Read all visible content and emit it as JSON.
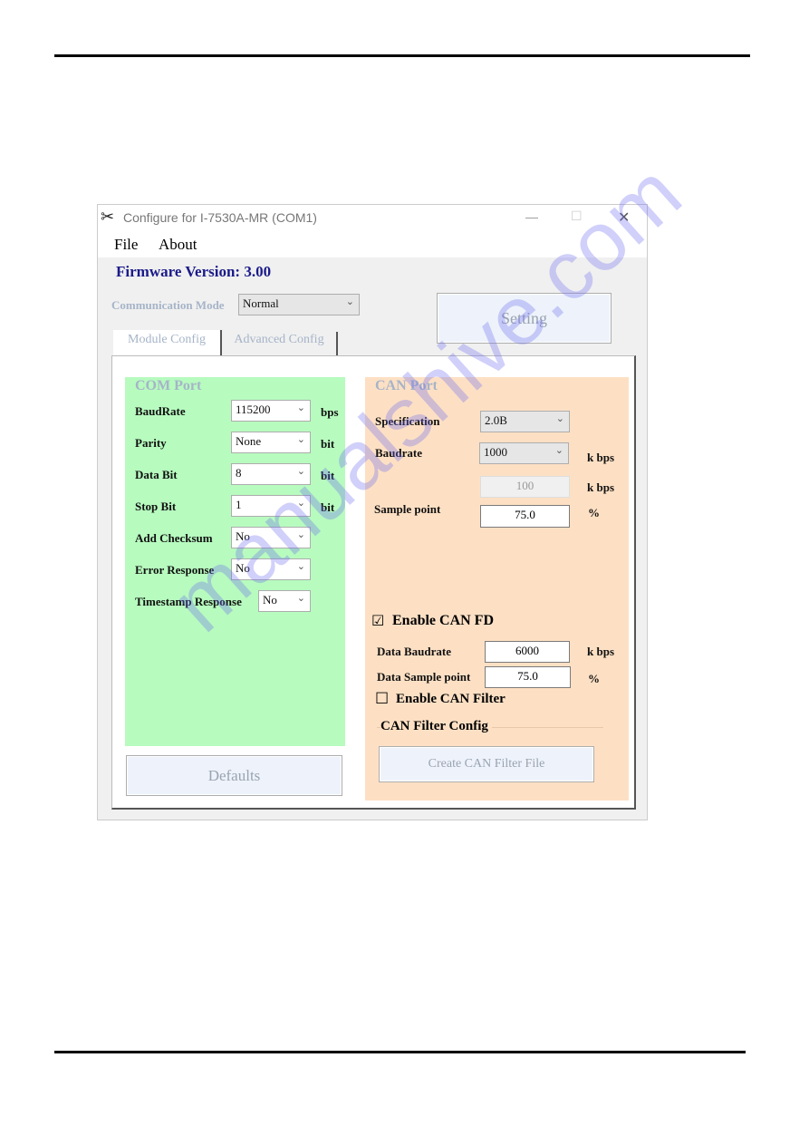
{
  "window": {
    "title": "Configure for I-7530A-MR (COM1)",
    "minimize": "—",
    "maximize": "☐",
    "close": "✕"
  },
  "menu": {
    "file": "File",
    "about": "About"
  },
  "firmware": "Firmware Version: 3.00",
  "comm_mode": {
    "label": "Communication Mode",
    "value": "Normal"
  },
  "setting_button": "Setting",
  "tabs": [
    {
      "label": "Module Config"
    },
    {
      "label": "Advanced Config"
    }
  ],
  "com_port": {
    "title": "COM Port",
    "rows": [
      {
        "label": "BaudRate",
        "value": "115200",
        "unit": "bps"
      },
      {
        "label": "Parity",
        "value": "None",
        "unit": "bit"
      },
      {
        "label": "Data Bit",
        "value": "8",
        "unit": "bit"
      },
      {
        "label": "Stop Bit",
        "value": "1",
        "unit": "bit"
      },
      {
        "label": "Add Checksum",
        "value": "No"
      },
      {
        "label": "Error Response",
        "value": "No"
      },
      {
        "label": "Timestamp Response",
        "value": "No"
      }
    ],
    "defaults_button": "Defaults",
    "color": "#b7fbbf"
  },
  "can_port": {
    "title": "CAN Port",
    "specification": {
      "label": "Specification",
      "value": "2.0B"
    },
    "baudrate": {
      "label": "Baudrate",
      "value": "1000",
      "unit": "k bps"
    },
    "custom_baud": {
      "value": "100",
      "unit": "k bps"
    },
    "sample_point": {
      "label": "Sample point",
      "value": "75.0",
      "unit": "%"
    },
    "enable_fd": {
      "label": "Enable CAN FD",
      "checked": true,
      "mark": "☑"
    },
    "data_baudrate": {
      "label": "Data Baudrate",
      "value": "6000",
      "unit": "k bps"
    },
    "data_sample_point": {
      "label": "Data Sample point",
      "value": "75.0",
      "unit": "%"
    },
    "enable_filter": {
      "label": "Enable CAN Filter",
      "checked": false,
      "mark": "☐"
    },
    "filter_group": "CAN Filter Config",
    "create_filter_button": "Create CAN Filter File",
    "color": "#fde0c4"
  },
  "watermark": "manualshive.com"
}
